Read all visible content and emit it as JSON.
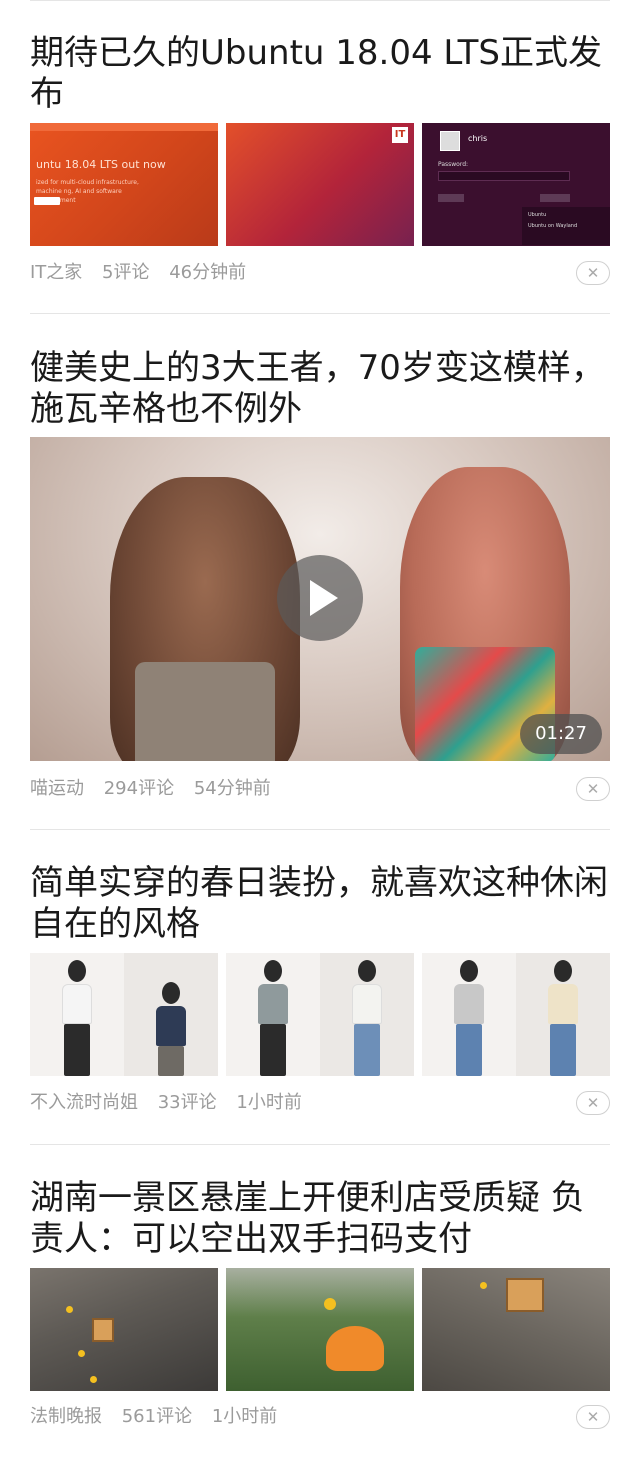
{
  "articles": [
    {
      "title": "期待已久的Ubuntu 18.04 LTS正式发布",
      "source": "IT之家",
      "comments": "5评论",
      "time": "46分钟前",
      "images": [
        {
          "text": "untu 18.04 LTS out now",
          "sub": "ized for multi-cloud infrastructure, machine ng, AI and software development"
        },
        {
          "logo": "IT"
        },
        {
          "user": "chris",
          "password_label": "Password:",
          "menu": [
            "Ubuntu",
            "Ubuntu on Wayland"
          ]
        }
      ]
    },
    {
      "title": "健美史上的3大王者，70岁变这模样，施瓦辛格也不例外",
      "source": "喵运动",
      "comments": "294评论",
      "time": "54分钟前",
      "video": {
        "duration": "01:27"
      }
    },
    {
      "title": "简单实穿的春日装扮，就喜欢这种休闲自在的风格",
      "source": "不入流时尚姐",
      "comments": "33评论",
      "time": "1小时前"
    },
    {
      "title": "湖南一景区悬崖上开便利店受质疑 负责人：可以空出双手扫码支付",
      "source": "法制晚报",
      "comments": "561评论",
      "time": "1小时前"
    }
  ],
  "icons": {
    "close": "close-icon",
    "play": "play-icon"
  },
  "colors": {
    "title": "#1a1a1a",
    "meta": "#9b9b9b",
    "divider": "#e5e5e5",
    "ubuntu_orange": "#e95420"
  }
}
